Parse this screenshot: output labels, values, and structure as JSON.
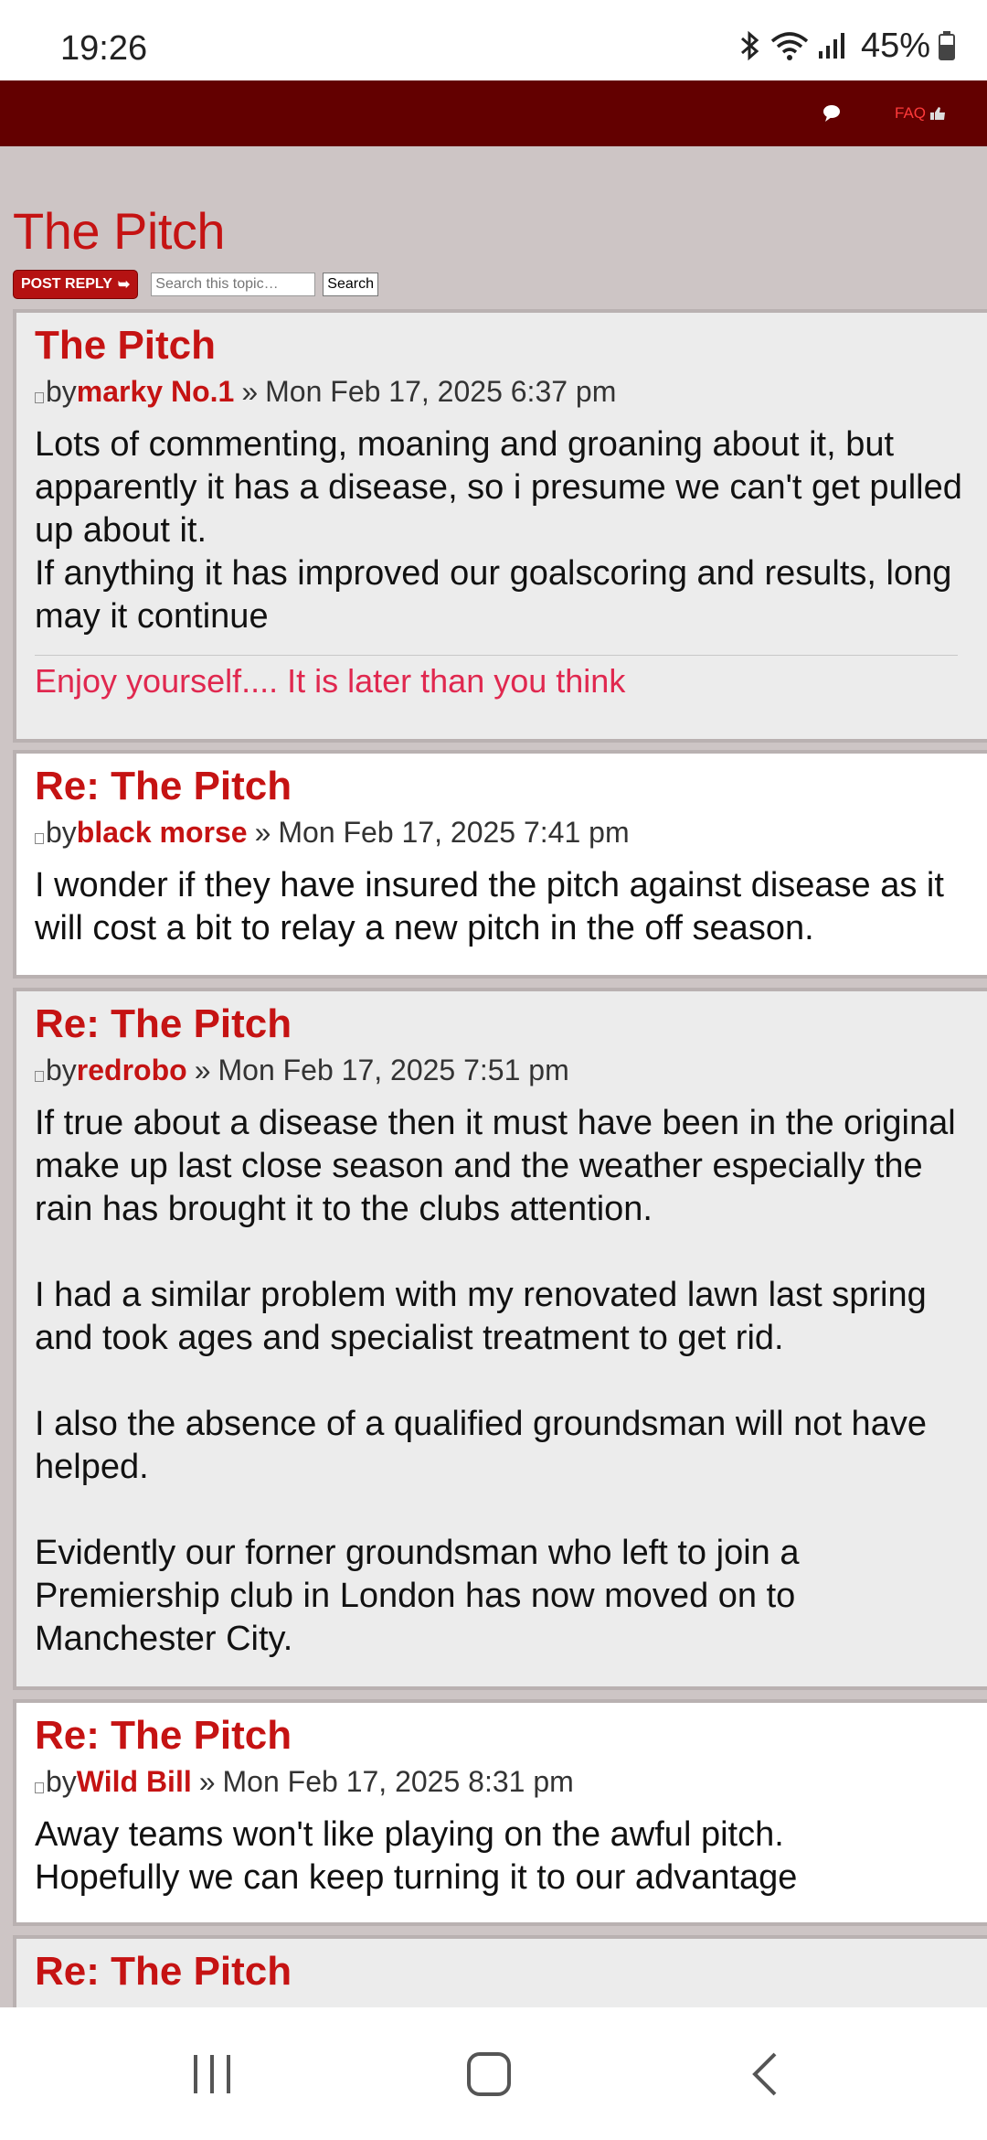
{
  "status_bar": {
    "time": "19:26",
    "battery": "45%"
  },
  "header": {
    "faq_label": "FAQ"
  },
  "topic": {
    "title": "The Pitch",
    "post_reply_label": "POST REPLY",
    "search_placeholder": "Search this topic…",
    "search_button": "Search"
  },
  "posts": [
    {
      "title": "The Pitch",
      "by": "by",
      "author": "marky No.1",
      "separator": "»",
      "date": "Mon Feb 17, 2025 6:37 pm",
      "lines": [
        "Lots of commenting, moaning and groaning about it, but apparently it has a disease, so i presume we can't get pulled up about it.",
        "If anything it has improved our goalscoring and results, long may it continue"
      ],
      "signature": "Enjoy yourself.... It is later than you think"
    },
    {
      "title": "Re: The Pitch",
      "by": "by",
      "author": "black morse",
      "separator": "»",
      "date": "Mon Feb 17, 2025 7:41 pm",
      "lines": [
        "I wonder if they have insured the pitch against disease as it will cost a bit to relay a new pitch in the off season."
      ]
    },
    {
      "title": "Re: The Pitch",
      "by": "by",
      "author": "redrobo",
      "separator": "»",
      "date": "Mon Feb 17, 2025 7:51 pm",
      "lines": [
        "If true about a disease then it must have been in the original make up last close season and the weather especially the rain has brought it to the clubs attention.",
        "",
        "I had a similar problem with my renovated lawn last spring and took ages and specialist treatment to get rid.",
        "",
        "I also the absence of a qualified groundsman will not have helped.",
        "",
        "Evidently our forner groundsman who left to join a Premiership club in London has now moved on to Manchester City."
      ]
    },
    {
      "title": "Re: The Pitch",
      "by": "by",
      "author": "Wild Bill",
      "separator": "»",
      "date": "Mon Feb 17, 2025 8:31 pm",
      "lines": [
        "Away teams won't like playing on the awful pitch.",
        "Hopefully we can keep turning it to our advantage"
      ]
    },
    {
      "title": "Re: The Pitch"
    }
  ]
}
